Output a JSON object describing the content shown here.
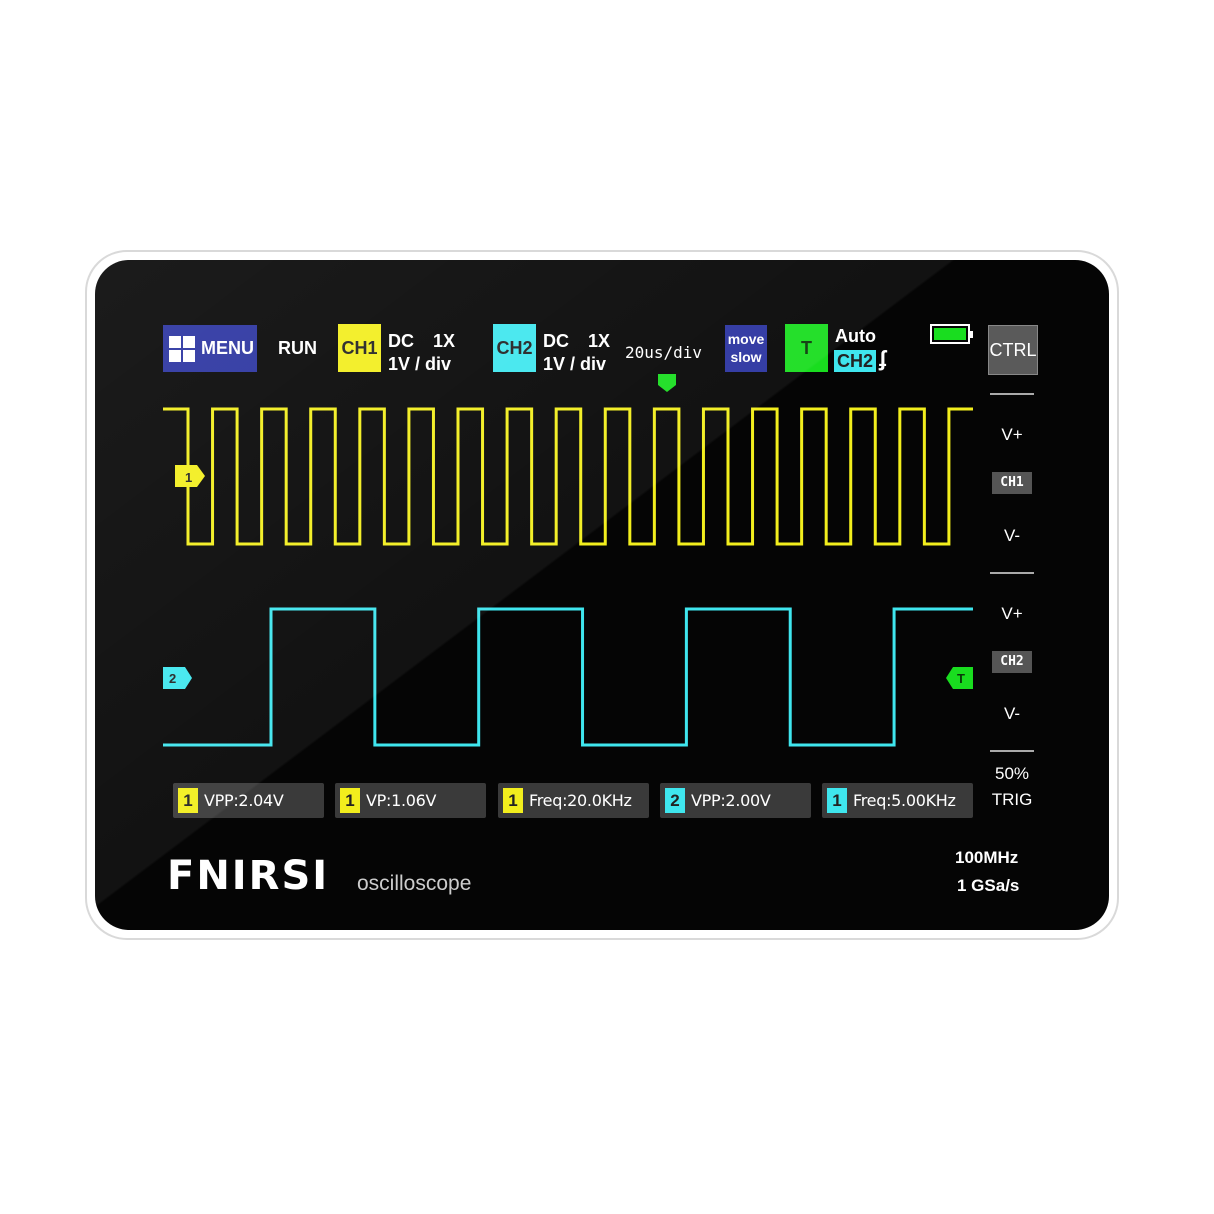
{
  "topbar": {
    "menu_label": "MENU",
    "run_status": "RUN",
    "ch1": {
      "tag": "CH1",
      "coupling": "DC",
      "probe": "1X",
      "scale": "1V / div"
    },
    "ch2": {
      "tag": "CH2",
      "coupling": "DC",
      "probe": "1X",
      "scale": "1V / div"
    },
    "timebase": "20us/div",
    "move_line1": "move",
    "move_line2": "slow",
    "trigger_button": "T",
    "trigger_mode": "Auto",
    "trigger_source": "CH2",
    "trigger_edge": "ʄ",
    "battery_level": 1.0,
    "ctrl_label": "CTRL"
  },
  "side_panel": {
    "ch1": {
      "v_plus": "V+",
      "label": "CH1",
      "v_minus": "V-"
    },
    "ch2": {
      "v_plus": "V+",
      "label": "CH2",
      "v_minus": "V-"
    },
    "trig_percent": "50%",
    "trig_label": "TRIG"
  },
  "markers": {
    "ch1": "1",
    "ch2": "2",
    "trigger": "T"
  },
  "measurements": [
    {
      "channel": "1",
      "text": "VPP:2.04V",
      "color": "#f2ee1d"
    },
    {
      "channel": "1",
      "text": "VP:1.06V",
      "color": "#f2ee1d"
    },
    {
      "channel": "1",
      "text": "Freq:20.0KHz",
      "color": "#f2ee1d"
    },
    {
      "channel": "2",
      "text": "VPP:2.00V",
      "color": "#3fe6ee"
    },
    {
      "channel": "1",
      "text": "Freq:5.00KHz",
      "color": "#3fe6ee"
    }
  ],
  "branding": {
    "logo": "FNIRSI",
    "product": "oscilloscope",
    "bandwidth": "100MHz",
    "sample_rate": "1 GSa/s"
  },
  "colors": {
    "ch1": "#f2ee1d",
    "ch2": "#3fe6ee",
    "trigger": "#19dd1f",
    "menu": "#2a33a0"
  },
  "waveforms": {
    "ch1": {
      "frequency_khz": 20.0,
      "cycles_visible": 16,
      "vpp": 2.04
    },
    "ch2": {
      "frequency_khz": 5.0,
      "cycles_visible": 4,
      "vpp": 2.0
    }
  }
}
